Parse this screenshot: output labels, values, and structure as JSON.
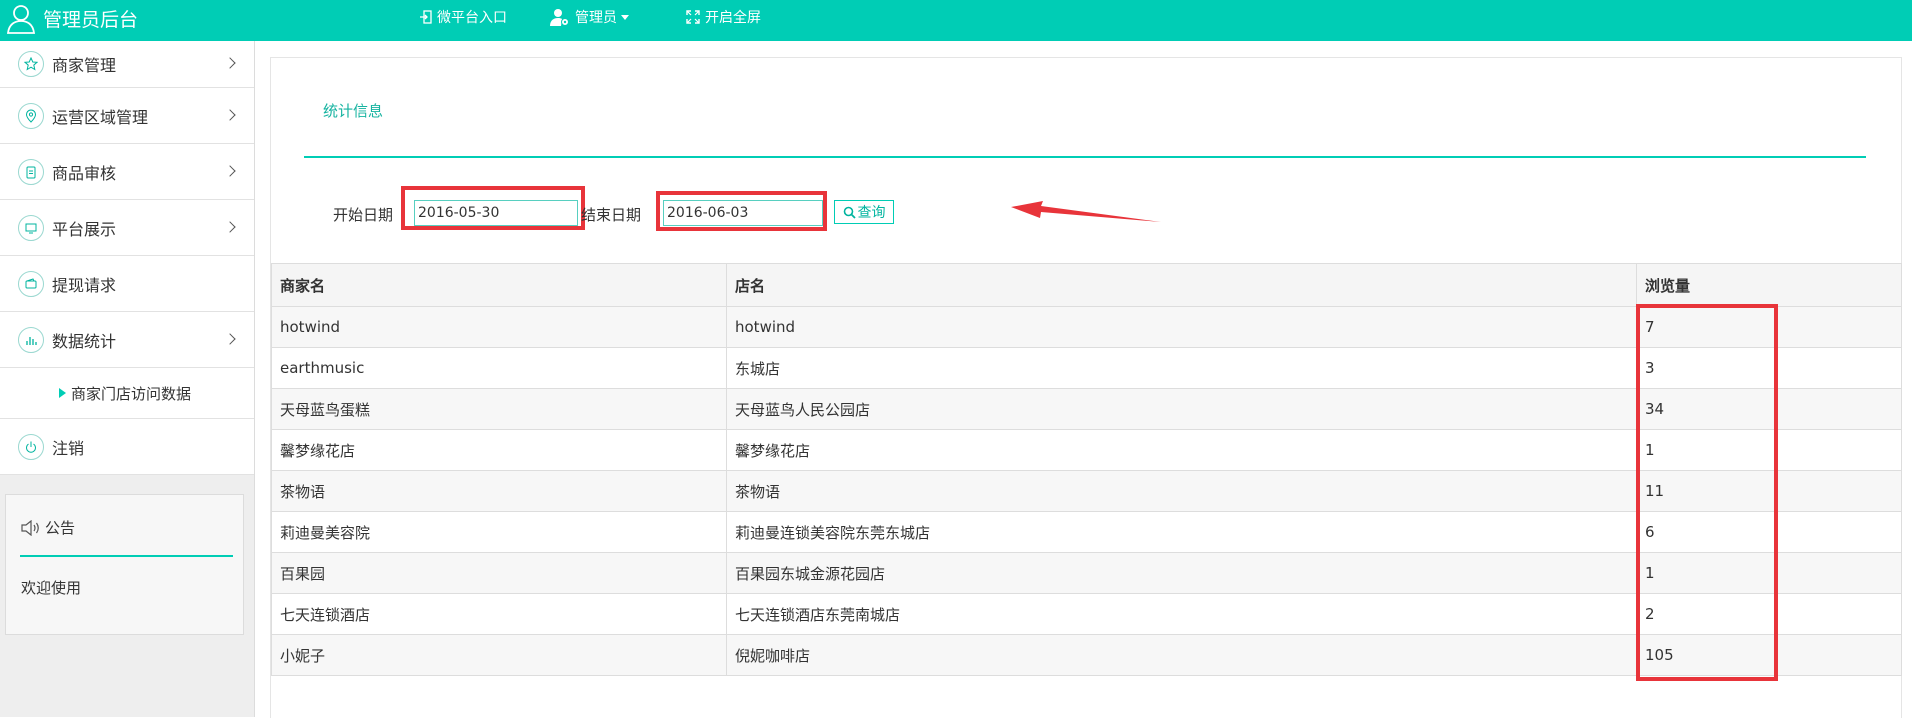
{
  "header": {
    "title": "管理员后台",
    "nav": {
      "weixin_label": "微平台入口",
      "admin_label": "管理员",
      "fullscreen_label": "开启全屏"
    },
    "brand_color": "#00cdb5"
  },
  "sidebar": {
    "items": [
      {
        "label": "商家管理",
        "icon": "star-icon"
      },
      {
        "label": "运营区域管理",
        "icon": "location-icon"
      },
      {
        "label": "商品审核",
        "icon": "clipboard-icon"
      },
      {
        "label": "平台展示",
        "icon": "display-icon"
      },
      {
        "label": "提现请求",
        "icon": "wallet-icon"
      },
      {
        "label": "数据统计",
        "icon": "bar-chart-icon"
      }
    ],
    "sub_item": "商家门店访问数据",
    "logout": "注销",
    "notice": {
      "title": "公告",
      "body": "欢迎使用"
    }
  },
  "main": {
    "title": "统计信息",
    "filter": {
      "start_label": "开始日期",
      "start_value": "2016-05-30",
      "end_label": "结束日期",
      "end_value": "2016-06-03",
      "query_label": "查询"
    },
    "table": {
      "headers": [
        "商家名",
        "店名",
        "浏览量"
      ],
      "rows": [
        [
          "hotwind",
          "hotwind",
          "7"
        ],
        [
          "earthmusic",
          "东城店",
          "3"
        ],
        [
          "天母蓝鸟蛋糕",
          "天母蓝鸟人民公园店",
          "34"
        ],
        [
          "馨梦缘花店",
          "馨梦缘花店",
          "1"
        ],
        [
          "茶物语",
          "茶物语",
          "11"
        ],
        [
          "莉迪曼美容院",
          "莉迪曼连锁美容院东莞东城店",
          "6"
        ],
        [
          "百果园",
          "百果园东城金源花园店",
          "1"
        ],
        [
          "七天连锁酒店",
          "七天连锁酒店东莞南城店",
          "2"
        ],
        [
          "小妮子",
          "倪妮咖啡店",
          "105"
        ]
      ]
    },
    "annotation_color": "#e8343a"
  }
}
